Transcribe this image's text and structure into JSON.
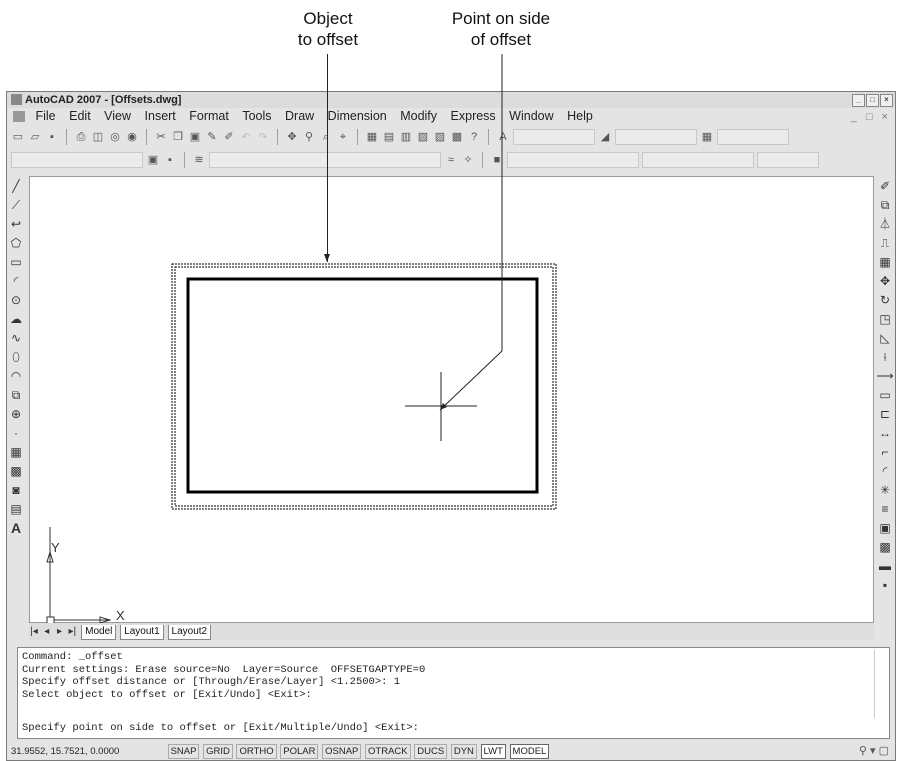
{
  "callouts": {
    "object_to_offset": [
      "Object",
      "to offset"
    ],
    "point_on_side": [
      "Point on side",
      "of offset"
    ]
  },
  "window": {
    "title": "AutoCAD 2007 - [Offsets.dwg]"
  },
  "menu": [
    "File",
    "Edit",
    "View",
    "Insert",
    "Format",
    "Tools",
    "Draw",
    "Dimension",
    "Modify",
    "Express",
    "Window",
    "Help"
  ],
  "axes": {
    "y": "Y",
    "x": "X"
  },
  "layout_tabs": [
    "Model",
    "Layout1",
    "Layout2"
  ],
  "command_lines": [
    "Command: _offset",
    "Current settings: Erase source=No  Layer=Source  OFFSETGAPTYPE=0",
    "Specify offset distance or [Through/Erase/Layer] <1.2500>: 1",
    "Select object to offset or [Exit/Undo] <Exit>:"
  ],
  "command_prompt": "Specify point on side to offset or [Exit/Multiple/Undo] <Exit>:",
  "status": {
    "coords": "31.9552, 15.7521, 0.0000",
    "toggles": [
      "SNAP",
      "GRID",
      "ORTHO",
      "POLAR",
      "OSNAP",
      "OTRACK",
      "DUCS",
      "DYN",
      "LWT",
      "MODEL"
    ],
    "active_toggles": [
      "LWT",
      "MODEL"
    ]
  },
  "icons": {
    "draw_palette": [
      "line-icon",
      "construction-line-icon",
      "polyline-icon",
      "polygon-icon",
      "rectangle-icon",
      "arc-icon",
      "circle-icon",
      "revision-cloud-icon",
      "spline-icon",
      "ellipse-icon",
      "ellipse-arc-icon",
      "insert-block-icon",
      "make-block-icon",
      "point-icon",
      "hatch-icon",
      "gradient-icon",
      "region-icon",
      "table-icon",
      "multiline-text-icon"
    ],
    "modify_palette": [
      "erase-icon",
      "copy-icon",
      "mirror-icon",
      "offset-icon",
      "array-icon",
      "move-icon",
      "rotate-icon",
      "scale-icon",
      "stretch-icon",
      "trim-icon",
      "extend-icon",
      "break-at-point-icon",
      "break-icon",
      "join-icon",
      "chamfer-icon",
      "fillet-icon",
      "explode-icon"
    ]
  },
  "colors": {
    "drawing": "#000000",
    "canvas": "#ffffff"
  }
}
